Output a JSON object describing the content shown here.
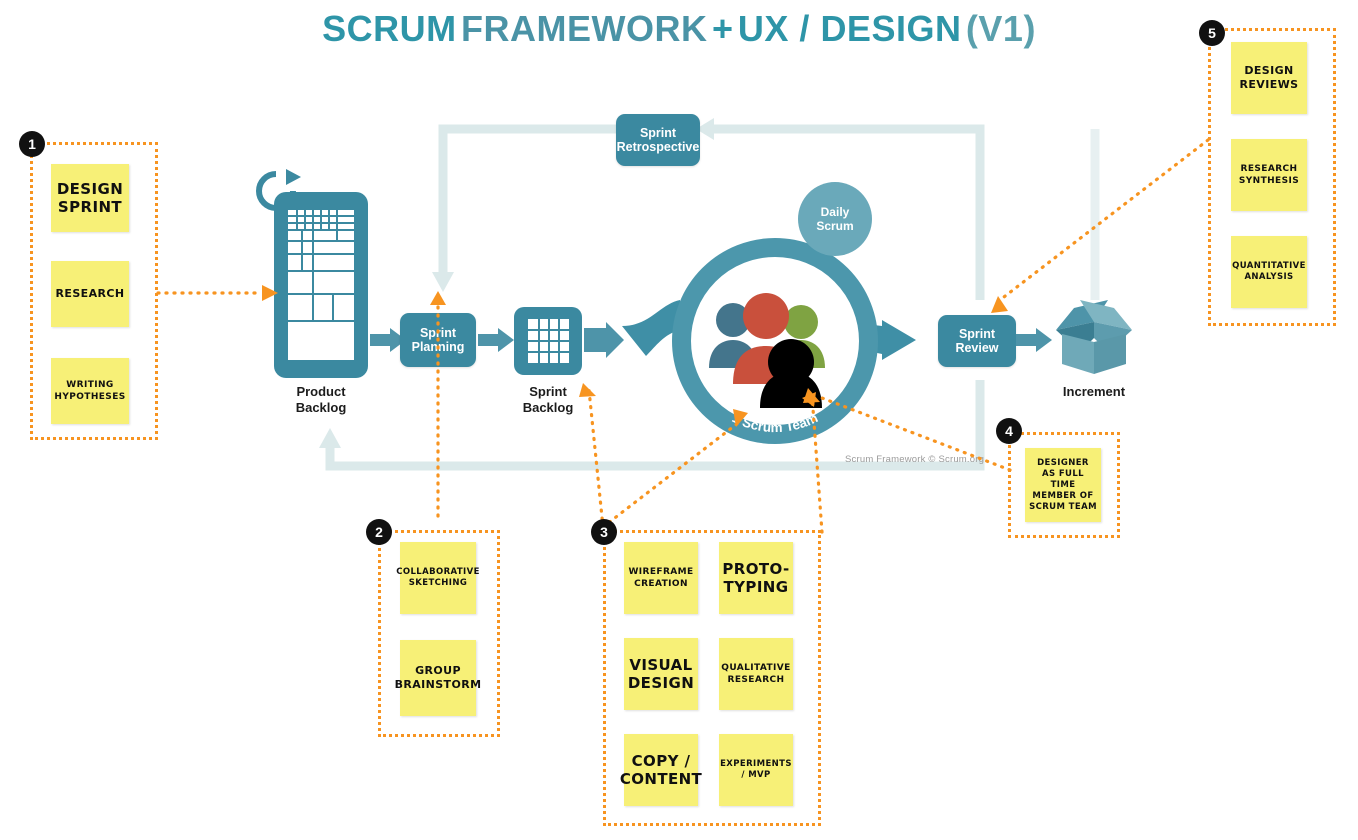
{
  "title": {
    "part1": "SCRUM",
    "part2": "FRAMEWORK",
    "part3": "+",
    "part4": "UX / DESIGN",
    "part5": "(V1)"
  },
  "colors": {
    "teal": "#3b89a0",
    "teal_light": "#6aa9ba",
    "teal_pale": "#dbe9ea",
    "title_teal": "#2e95a8",
    "title_gray": "#4a93a6",
    "orange": "#f79420",
    "sticky_yellow": "#f7f077",
    "badge_black": "#111111",
    "person_blue": "#44758c",
    "person_red": "#c9503c",
    "person_green": "#7fa342",
    "person_black": "#000000"
  },
  "scrum": {
    "product_backlog_label": "Product\nBacklog",
    "product_backlog_line1": "Product",
    "product_backlog_line2": "Backlog",
    "sprint_planning": "Sprint\nPlanning",
    "sprint_planning_line1": "Sprint",
    "sprint_planning_line2": "Planning",
    "sprint_backlog_line1": "Sprint",
    "sprint_backlog_line2": "Backlog",
    "daily_scrum_line1": "Daily",
    "daily_scrum_line2": "Scrum",
    "sprint_retrospective_line1": "Sprint",
    "sprint_retrospective_line2": "Retrospective",
    "sprint_review_line1": "Sprint",
    "sprint_review_line2": "Review",
    "scrum_team_ring_label": "1 Scrum Team",
    "increment_label": "Increment",
    "copyright": "Scrum Framework © Scrum.org"
  },
  "groups": [
    {
      "number": "1",
      "notes": [
        {
          "text": "DESIGN\nSPRINT",
          "line1": "DESIGN",
          "line2": "SPRINT",
          "size": "lg"
        },
        {
          "text": "RESEARCH",
          "line1": "RESEARCH",
          "line2": "",
          "size": "md"
        },
        {
          "text": "WRITING\nHYPOTHESES",
          "line1": "WRITING",
          "line2": "HYPOTHESES",
          "size": "xs"
        }
      ]
    },
    {
      "number": "2",
      "notes": [
        {
          "text": "COLLABORATIVE\nSKETCHING",
          "line1": "COLLABORATIVE",
          "line2": "SKETCHING",
          "size": "sm"
        },
        {
          "text": "GROUP\nBRAINSTORM",
          "line1": "GROUP",
          "line2": "BRAINSTORM",
          "size": "md"
        }
      ]
    },
    {
      "number": "3",
      "notes": [
        {
          "text": "WIREFRAME\nCREATION",
          "line1": "WIREFRAME",
          "line2": "CREATION",
          "size": "xs"
        },
        {
          "text": "PROTO-\nTYPING",
          "line1": "PROTO-",
          "line2": "TYPING",
          "size": "lg"
        },
        {
          "text": "VISUAL\nDESIGN",
          "line1": "VISUAL",
          "line2": "DESIGN",
          "size": "lg"
        },
        {
          "text": "QUALITATIVE\nRESEARCH",
          "line1": "QUALITATIVE",
          "line2": "RESEARCH",
          "size": "xs"
        },
        {
          "text": "COPY /\nCONTENT",
          "line1": "COPY /",
          "line2": "CONTENT",
          "size": "lg"
        },
        {
          "text": "EXPERIMENTS\n/ MVP",
          "line1": "EXPERIMENTS",
          "line2": "/ MVP",
          "size": "sm"
        }
      ]
    },
    {
      "number": "4",
      "notes": [
        {
          "text": "DESIGNER\nAS FULL TIME\nMEMBER OF\nSCRUM TEAM",
          "line1": "DESIGNER",
          "line2": "AS FULL TIME",
          "line3": "MEMBER OF",
          "line4": "SCRUM TEAM",
          "size": "sm"
        }
      ]
    },
    {
      "number": "5",
      "notes": [
        {
          "text": "DESIGN\nREVIEWS",
          "line1": "DESIGN",
          "line2": "REVIEWS",
          "size": "md"
        },
        {
          "text": "RESEARCH\nSYNTHESIS",
          "line1": "RESEARCH",
          "line2": "SYNTHESIS",
          "size": "xs"
        },
        {
          "text": "QUANTITATIVE\nANALYSIS",
          "line1": "QUANTITATIVE",
          "line2": "ANALYSIS",
          "size": "sm"
        }
      ]
    }
  ]
}
